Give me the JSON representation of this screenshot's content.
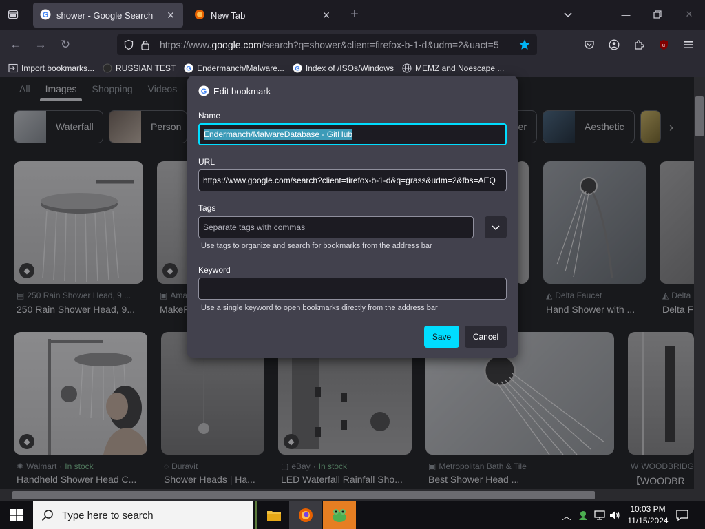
{
  "browser": {
    "tabs": [
      {
        "title": "shower - Google Search",
        "active": true
      },
      {
        "title": "New Tab",
        "active": false
      }
    ],
    "url": {
      "prefix": "https://www.",
      "domain": "google.com",
      "suffix": "/search?q=shower&client=firefox-b-1-d&udm=2&uact=5"
    },
    "extension_badge": "16",
    "bookmarks": [
      {
        "label": "Import bookmarks...",
        "icon": "import-icon"
      },
      {
        "label": "RUSSIAN TEST",
        "icon": "globe-dark-icon"
      },
      {
        "label": "Endermanch/Malware...",
        "icon": "google-icon"
      },
      {
        "label": "Index of /ISOs/Windows",
        "icon": "google-icon"
      },
      {
        "label": "MEMZ and Noescape ...",
        "icon": "globe-icon"
      }
    ]
  },
  "page": {
    "search_tabs": [
      {
        "label": "All",
        "active": false
      },
      {
        "label": "Images",
        "active": true
      },
      {
        "label": "Shopping",
        "active": false
      },
      {
        "label": "Videos",
        "active": false
      }
    ],
    "chips": {
      "waterfall": "Waterfall",
      "person": "Person",
      "partial": "er",
      "aesthetic": "Aesthetic"
    },
    "row1": [
      {
        "source": "250 Rain Shower Head, 9 ...",
        "caption": "250 Rain Shower Head, 9..."
      },
      {
        "source": "Ama",
        "caption": "MakeF"
      },
      {
        "source": "Delta Faucet",
        "caption": "Hand Shower with ..."
      },
      {
        "source": "Delta",
        "caption": "Delta F"
      }
    ],
    "row2": [
      {
        "source": "Walmart",
        "stock": "In stock",
        "caption": "Handheld Shower Head C..."
      },
      {
        "source": "Duravit",
        "caption": "Shower Heads | Ha..."
      },
      {
        "source": "eBay",
        "stock": "In stock",
        "caption": "LED Waterfall Rainfall Sho..."
      },
      {
        "source": "Metropolitan Bath & Tile",
        "caption": "Best Shower Head ..."
      },
      {
        "source": "WOODBRIDG",
        "caption": "【WOODBR"
      }
    ]
  },
  "dialog": {
    "title": "Edit bookmark",
    "name": {
      "label": "Name",
      "value": "Endermanch/MalwareDatabase - GitHub"
    },
    "url": {
      "label": "URL",
      "value": "https://www.google.com/search?client=firefox-b-1-d&q=grass&udm=2&fbs=AEQ"
    },
    "tags": {
      "label": "Tags",
      "placeholder": "Separate tags with commas",
      "hint": "Use tags to organize and search for bookmarks from the address bar"
    },
    "keyword": {
      "label": "Keyword",
      "value": "",
      "hint": "Use a single keyword to open bookmarks directly from the address bar"
    },
    "save": "Save",
    "cancel": "Cancel",
    "accent": "#00ddff"
  },
  "taskbar": {
    "search_placeholder": "Type here to search",
    "time": "10:03 PM",
    "date": "11/15/2024"
  }
}
